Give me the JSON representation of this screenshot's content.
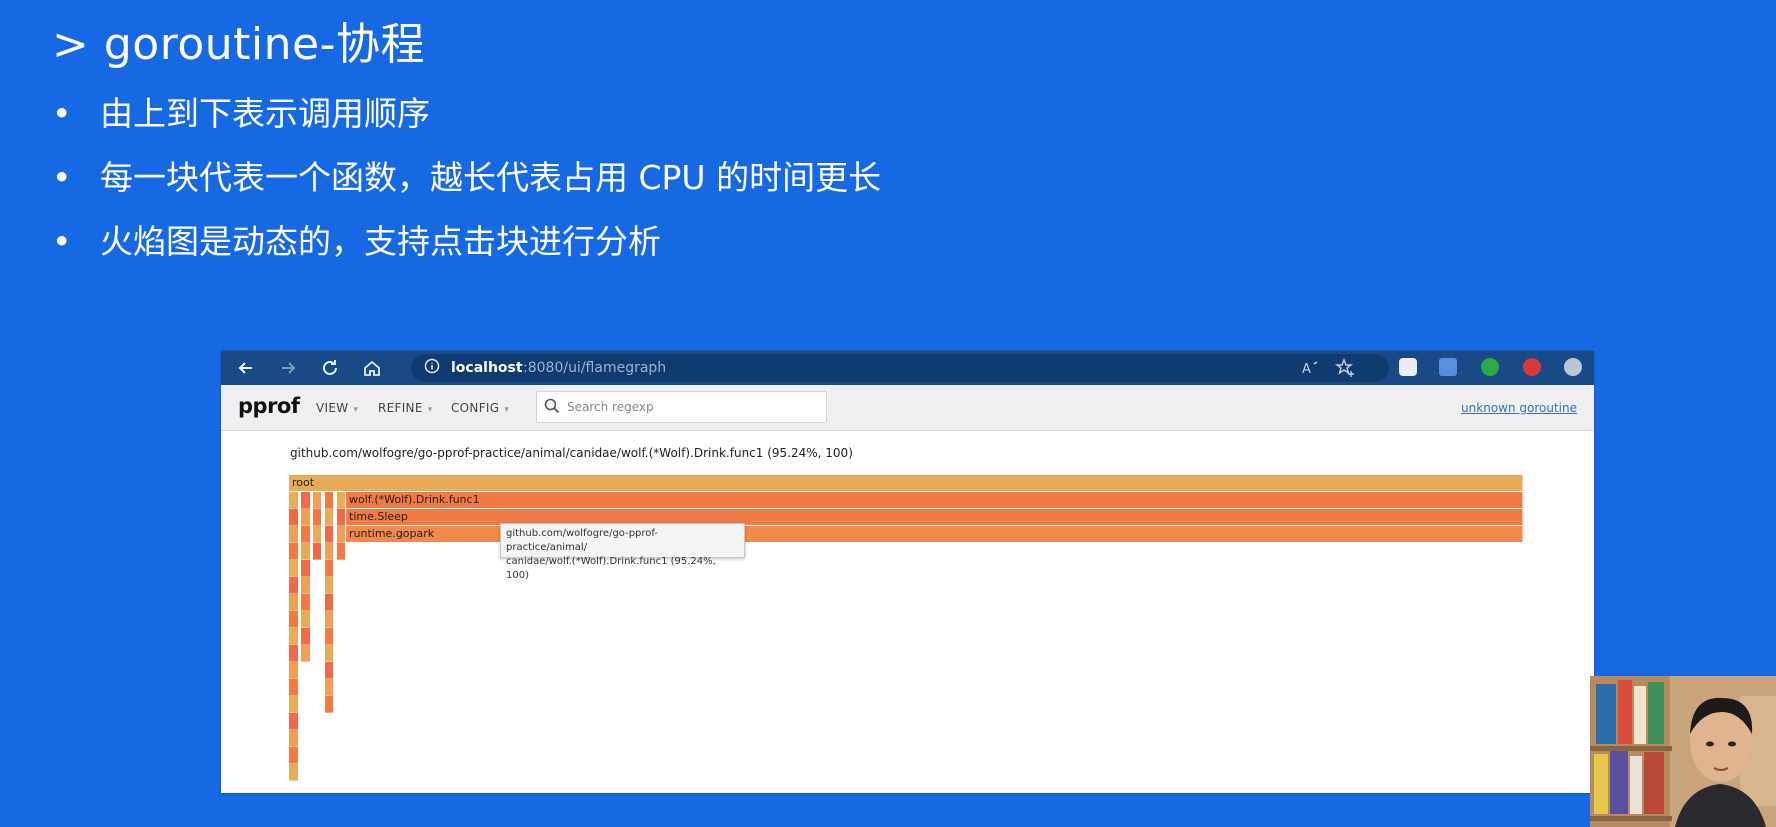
{
  "slide": {
    "title": "> goroutine-协程",
    "bullets": [
      {
        "dot": "•",
        "text": "由上到下表示调用顺序"
      },
      {
        "dot": "•",
        "text": "每一块代表一个函数，越长代表占用 CPU 的时间更长"
      },
      {
        "dot": "•",
        "text": "火焰图是动态的，支持点击块进行分析"
      }
    ]
  },
  "browser": {
    "url_host": "localhost",
    "url_path": ":8080/ui/flamegraph",
    "icons": {
      "back": "arrow-left-icon",
      "forward": "arrow-right-icon",
      "refresh": "refresh-icon",
      "home": "home-icon",
      "info": "info-icon",
      "read_aloud": "read-aloud-icon",
      "favorite_add": "star-plus-icon",
      "favorites": "favorites-icon",
      "collections": "collections-icon",
      "more": "more-icon"
    }
  },
  "pprof": {
    "logo": "pprof",
    "menus": [
      {
        "label": "VIEW",
        "caret": "▾"
      },
      {
        "label": "REFINE",
        "caret": "▾"
      },
      {
        "label": "CONFIG",
        "caret": "▾"
      }
    ],
    "search_placeholder": "Search regexp",
    "profile_link": "unknown goroutine"
  },
  "flamegraph": {
    "header": "github.com/wolfogre/go-pprof-practice/animal/canidae/wolf.(*Wolf).Drink.func1 (95.24%, 100)",
    "frames": [
      {
        "label": "root",
        "color": "#e8ac58"
      },
      {
        "label": "wolf.(*Wolf).Drink.func1",
        "color": "#f27a45"
      },
      {
        "label": "time.Sleep",
        "color": "#f27a45"
      },
      {
        "label": "runtime.gopark",
        "color": "#f28a4c"
      }
    ],
    "tooltip_lines": [
      "github.com/wolfogre/go-pprof-practice/animal/",
      "canidae/wolf.(*Wolf).Drink.func1 (95.24%, 100)"
    ]
  },
  "colors": {
    "slide_background": "#1669e2",
    "browser_toolbar": "#174a86",
    "frame_orange": "#f27a45",
    "frame_yellow": "#e8ac58",
    "frame_red": "#ef6a4a"
  }
}
